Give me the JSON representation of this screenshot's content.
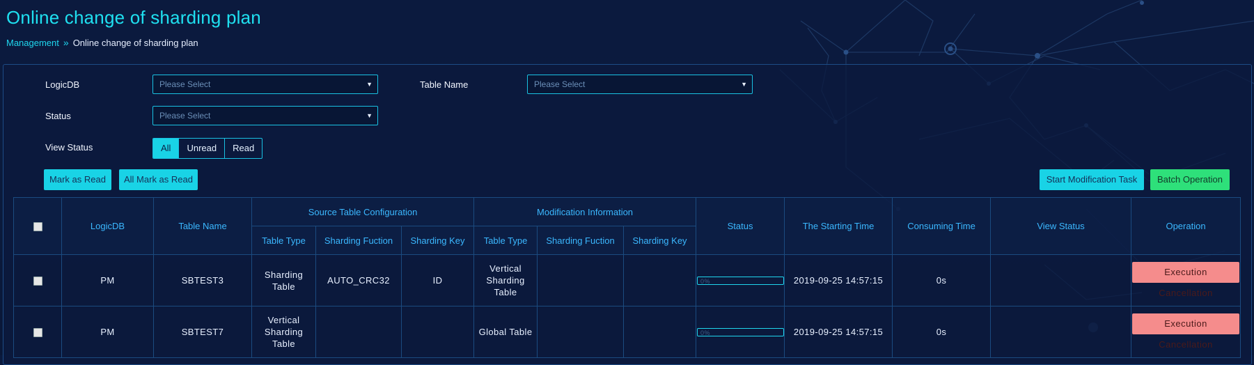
{
  "page_title": "Online change of sharding plan",
  "breadcrumb": {
    "parent": "Management",
    "separator": "»",
    "current": "Online change of sharding plan"
  },
  "filters": {
    "logicdb": {
      "label": "LogicDB",
      "placeholder": "Please Select"
    },
    "table_name": {
      "label": "Table Name",
      "placeholder": "Please Select"
    },
    "status": {
      "label": "Status",
      "placeholder": "Please Select"
    },
    "view_status": {
      "label": "View Status",
      "options": [
        "All",
        "Unread",
        "Read"
      ],
      "selected": "All"
    }
  },
  "actions": {
    "mark_as_read": "Mark as Read",
    "all_mark_as_read": "All Mark as Read",
    "start_modification_task": "Start Modification Task",
    "batch_operation": "Batch Operation"
  },
  "table": {
    "headers": {
      "logicdb": "LogicDB",
      "table_name": "Table Name",
      "source_group": "Source Table Configuration",
      "modification_group": "Modification Information",
      "table_type": "Table Type",
      "sharding_fuction": "Sharding Fuction",
      "sharding_key": "Sharding Key",
      "status": "Status",
      "starting_time": "The Starting Time",
      "consuming_time": "Consuming Time",
      "view_status": "View Status",
      "operation": "Operation"
    },
    "rows": [
      {
        "logicdb": "PM",
        "table_name": "SBTEST3",
        "src_table_type": "Sharding Table",
        "src_sharding_fuction": "AUTO_CRC32",
        "src_sharding_key": "ID",
        "mod_table_type": "Vertical Sharding Table",
        "mod_sharding_fuction": "",
        "mod_sharding_key": "",
        "progress_text": "0%",
        "progress": 0,
        "starting_time": "2019-09-25 14:57:15",
        "consuming_time": "0s",
        "view_status": "",
        "operation": "Execution Cancellation"
      },
      {
        "logicdb": "PM",
        "table_name": "SBTEST7",
        "src_table_type": "Vertical Sharding Table",
        "src_sharding_fuction": "",
        "src_sharding_key": "",
        "mod_table_type": "Global Table",
        "mod_sharding_fuction": "",
        "mod_sharding_key": "",
        "progress_text": "0%",
        "progress": 0,
        "starting_time": "2019-09-25 14:57:15",
        "consuming_time": "0s",
        "view_status": "",
        "operation": "Execution Cancellation"
      }
    ]
  },
  "colors": {
    "accent": "#19d3e6",
    "header_text": "#3bb8ff",
    "danger": "#f58c8c",
    "success": "#2ee07a"
  }
}
